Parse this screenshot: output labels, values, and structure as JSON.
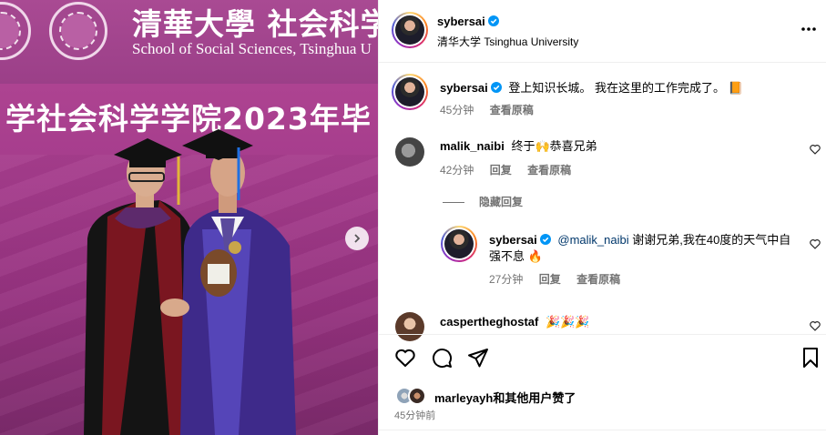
{
  "photo": {
    "school_cn": "清華大學 社会科学学",
    "school_en": "School of Social Sciences, Tsinghua U",
    "stage_text": "学社会科学学院2023年毕",
    "next_icon": "chevron-right-icon"
  },
  "header": {
    "username": "sybersai",
    "subtitle": "清华大学 Tsinghua University",
    "more_icon": "more-horizontal-icon"
  },
  "caption": {
    "username": "sybersai",
    "text": "登上知识长城。 我在这里的工作完成了。 📙",
    "time": "45分钟",
    "translate_label": "查看原稿"
  },
  "comments": [
    {
      "username": "malik_naibi",
      "text": "终于🙌恭喜兄弟",
      "time": "42分钟",
      "reply_label": "回复",
      "translate_label": "查看原稿"
    }
  ],
  "hide_replies_label": "隐藏回复",
  "reply": {
    "username": "sybersai",
    "mention": "@malik_naibi",
    "text": " 谢谢兄弟,我在40度的天气中自强不息 🔥",
    "time": "27分钟",
    "reply_label": "回复",
    "translate_label": "查看原稿"
  },
  "comment2": {
    "username": "caspertheghostaf",
    "text": "🎉🎉🎉"
  },
  "likes": {
    "user": "marleyayh",
    "suffix": "和其他用户赞了"
  },
  "post_time": "45分钟前",
  "colors": {
    "verified": "#0095f6",
    "mention": "#00376b",
    "meta": "#737373",
    "photo_bg": "#a53c8c"
  }
}
